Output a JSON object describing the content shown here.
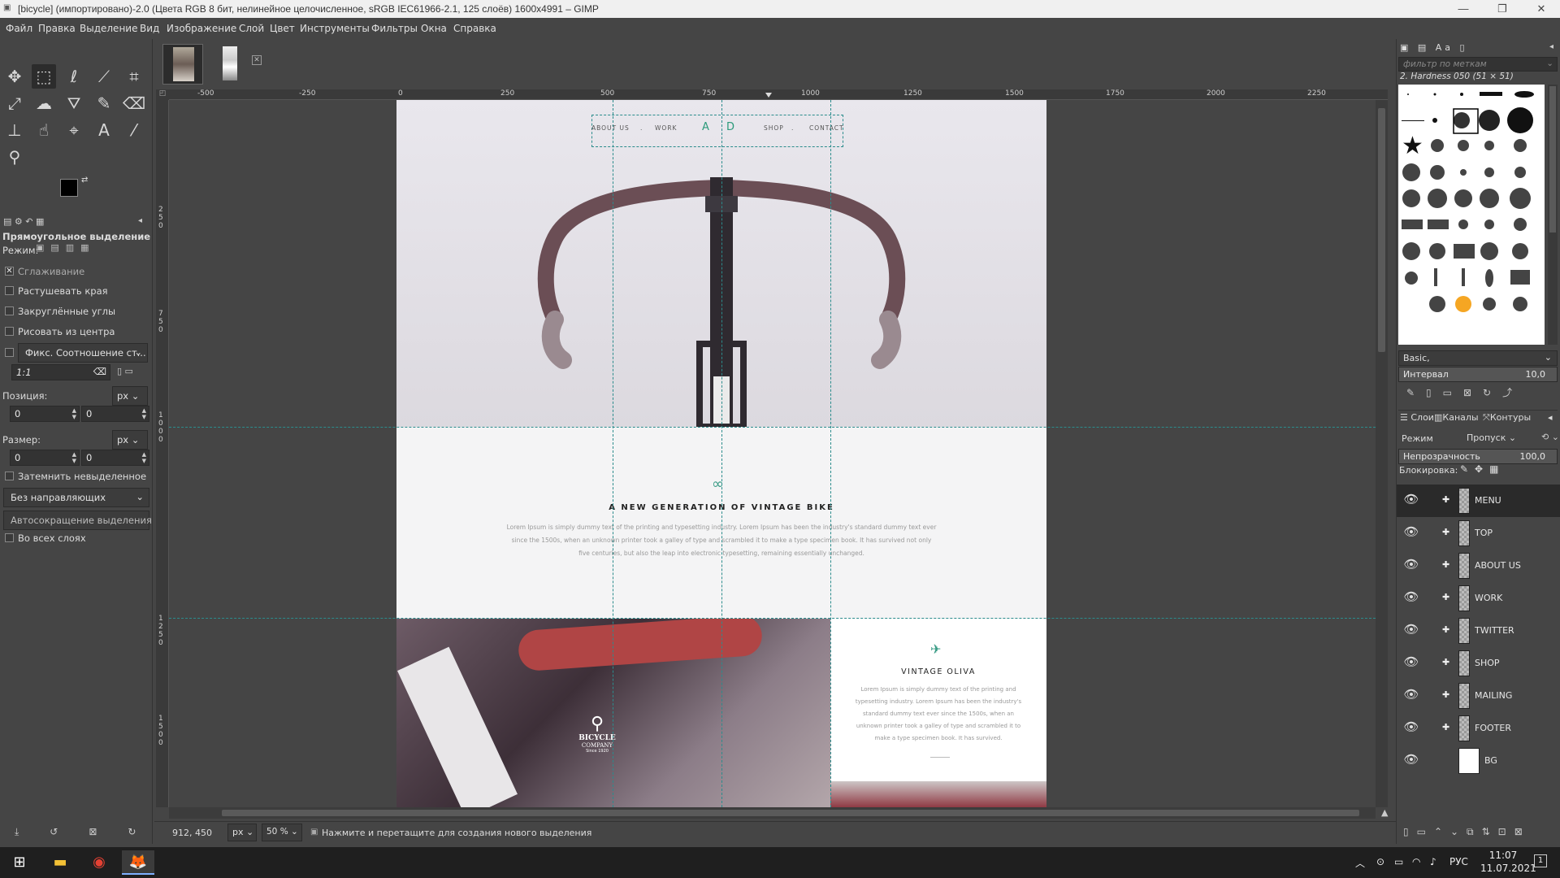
{
  "window": {
    "title": "[bicycle] (импортировано)-2.0 (Цвета RGB 8 бит, нелинейное целочисленное, sRGB IEC61966-2.1, 125 слоёв) 1600x4991 – GIMP",
    "minimize": "—",
    "maximize": "❐",
    "close": "✕"
  },
  "menu": [
    "Файл",
    "Правка",
    "Выделение",
    "Вид",
    "Изображение",
    "Слой",
    "Цвет",
    "Инструменты",
    "Фильтры",
    "Окна",
    "Справка"
  ],
  "tool_options": {
    "title": "Прямоугольное выделение",
    "mode_label": "Режим:",
    "antialias": "Сглаживание",
    "feather": "Растушевать края",
    "rounded": "Закруглённые углы",
    "from_center": "Рисовать из центра",
    "fixed": "Фикс. Соотношение ст...",
    "ratio": "1:1",
    "position_label": "Позиция:",
    "size_label": "Размер:",
    "unit": "px",
    "pos_x": "0",
    "pos_y": "0",
    "size_w": "0",
    "size_h": "0",
    "highlight": "Затемнить невыделенное",
    "guides": "Без направляющих",
    "autoshrink": "Автосокращение выделения",
    "all_layers": "Во всех слоях"
  },
  "ruler_h": [
    "-500",
    "-250",
    "0",
    "250",
    "500",
    "750",
    "1000",
    "1250",
    "1500",
    "1750",
    "2000",
    "2250"
  ],
  "ruler_v": [
    "2",
    "5",
    "0",
    "7",
    "5",
    "0",
    "1",
    "0",
    "0",
    "0",
    "1",
    "2",
    "5",
    "0",
    "1",
    "5",
    "0",
    "0"
  ],
  "canvas_art": {
    "nav": [
      "ABOUT US",
      ".",
      "WORK",
      "A",
      "D",
      "SHOP",
      ".",
      "CONTACT"
    ],
    "headline": "A NEW GENERATION OF VINTAGE BIKE",
    "body": "Lorem Ipsum is simply dummy text of the printing and typesetting industry. Lorem Ipsum has been the industry's standard dummy text ever since the 1500s, when an unknown printer took a galley of type and scrambled it to make a type specimen book. It has survived not only five centuries, but also the leap into electronic typesetting, remaining essentially unchanged.",
    "logo_line1": "BICYCLE",
    "logo_line2": "COMPANY",
    "logo_line3": "Since 1920",
    "card_title": "VINTAGE OLIVA",
    "card_body": "Lorem Ipsum is simply dummy text of the printing and typesetting industry. Lorem Ipsum has been the industry's standard dummy text ever since the 1500s, when an unknown printer took a galley of type and scrambled it to make a type specimen book. It has survived."
  },
  "status": {
    "coords": "912, 450",
    "unit": "px",
    "zoom": "50 %",
    "message": "Нажмите и перетащите для создания нового выделения"
  },
  "brushes": {
    "filter_placeholder": "фильтр по меткам",
    "current": "2. Hardness 050 (51 × 51)",
    "preset": "Basic,",
    "spacing_label": "Интервал",
    "spacing_value": "10,0"
  },
  "layers_panel": {
    "tabs": [
      "Слои",
      "Каналы",
      "Контуры"
    ],
    "mode_label": "Режим",
    "mode_value": "Пропуск",
    "opacity_label": "Непрозрачность",
    "opacity_value": "100,0",
    "lock_label": "Блокировка:",
    "layers": [
      "MENU",
      "TOP",
      "ABOUT US",
      "WORK",
      "TWITTER",
      "SHOP",
      "MAILING",
      "FOOTER",
      "BG"
    ]
  },
  "taskbar": {
    "lang": "РУС",
    "time": "11:07",
    "date": "11.07.2021",
    "notif": "1"
  }
}
